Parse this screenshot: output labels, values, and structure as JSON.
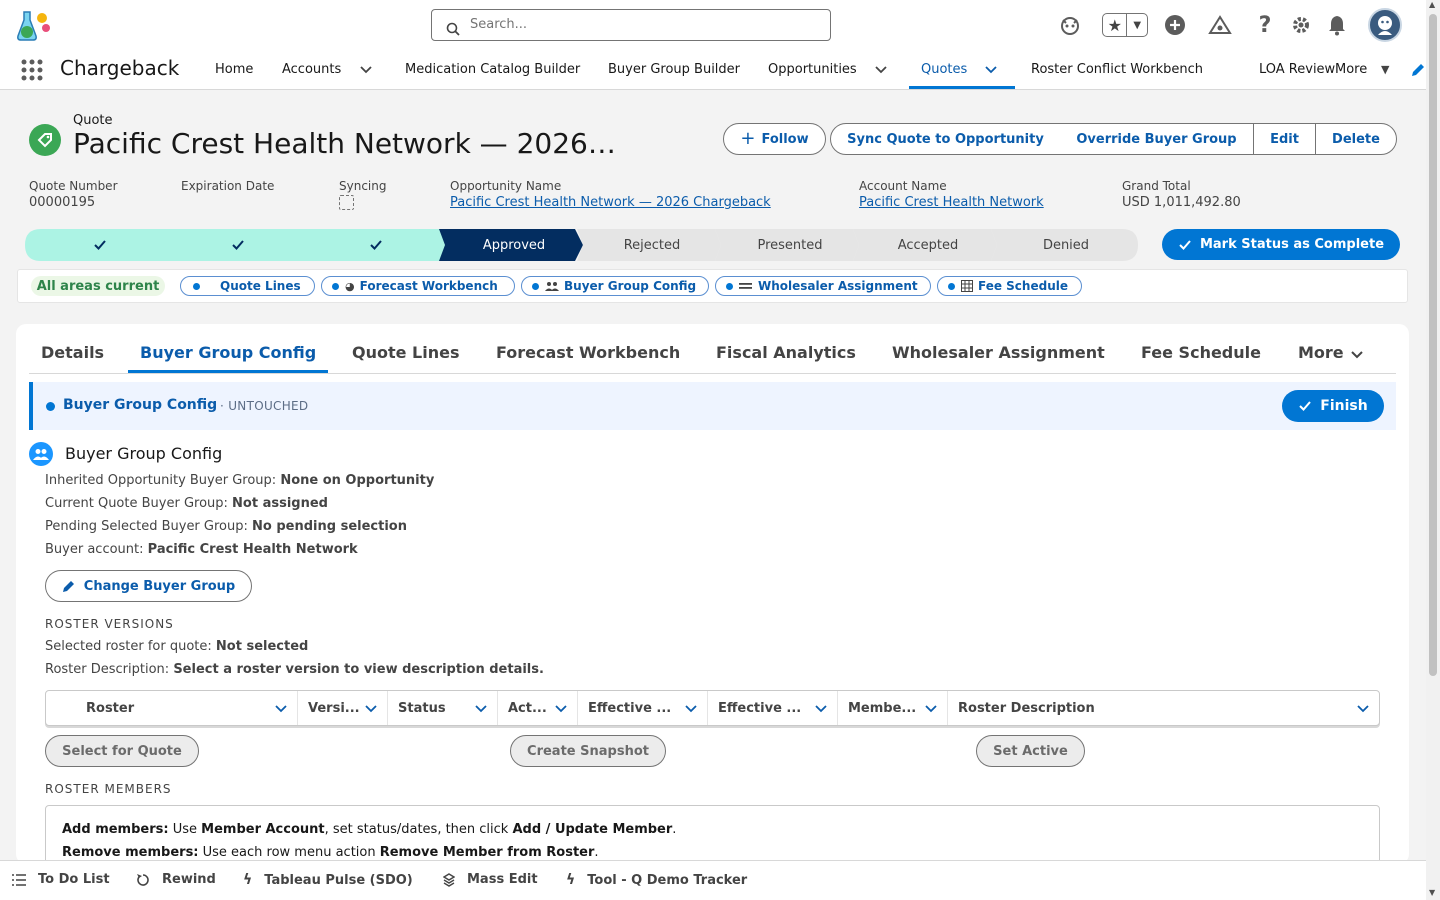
{
  "topbar": {
    "search_placeholder": "Search...",
    "icons": [
      "astro-icon",
      "favorites-star-icon",
      "favorites-dropdown-icon",
      "global-add-icon",
      "trailhead-icon",
      "help-icon",
      "setup-gear-icon",
      "notifications-bell-icon",
      "user-avatar"
    ]
  },
  "nav": {
    "app_name": "Chargeback",
    "items": [
      {
        "label": "Home"
      },
      {
        "label": "Accounts"
      },
      {
        "label": "Medication Catalog Builder"
      },
      {
        "label": "Buyer Group Builder"
      },
      {
        "label": "Opportunities"
      },
      {
        "label": "Quotes"
      },
      {
        "label": "Roster Conflict Workbench"
      },
      {
        "label": "LOA Review"
      },
      {
        "label": "More"
      }
    ]
  },
  "record": {
    "object_label": "Quote",
    "title": "Pacific Crest Health Network — 2026…",
    "actions": {
      "follow": "Follow",
      "sync": "Sync Quote to Opportunity",
      "override": "Override Buyer Group",
      "edit": "Edit",
      "delete": "Delete"
    },
    "fields": [
      {
        "label": "Quote Number",
        "value": "00000195"
      },
      {
        "label": "Expiration Date",
        "value": ""
      },
      {
        "label": "Syncing",
        "value": ""
      },
      {
        "label": "Opportunity Name",
        "value": "Pacific Crest Health Network — 2026 Chargeback"
      },
      {
        "label": "Account Name",
        "value": "Pacific Crest Health Network"
      },
      {
        "label": "Grand Total",
        "value": "USD 1,011,492.80"
      }
    ]
  },
  "path": {
    "stages": [
      "",
      "",
      "",
      "Approved",
      "Rejected",
      "Presented",
      "Accepted",
      "Denied"
    ],
    "complete_button": "Mark Status as Complete"
  },
  "areas": {
    "status": "All areas current",
    "pills": [
      "Quote Lines",
      "Forecast Workbench",
      "Buyer Group Config",
      "Wholesaler Assignment",
      "Fee Schedule"
    ]
  },
  "tabs": [
    "Details",
    "Buyer Group Config",
    "Quote Lines",
    "Forecast Workbench",
    "Fiscal Analytics",
    "Wholesaler Assignment",
    "Fee Schedule",
    "More"
  ],
  "banner": {
    "title": "Buyer Group Config",
    "status": "· UNTOUCHED",
    "finish": "Finish"
  },
  "section": {
    "title": "Buyer Group Config",
    "lines": [
      {
        "label": "Inherited Opportunity Buyer Group: ",
        "value": "None on Opportunity"
      },
      {
        "label": "Current Quote Buyer Group: ",
        "value": "Not assigned"
      },
      {
        "label": "Pending Selected Buyer Group: ",
        "value": "No pending selection"
      },
      {
        "label": "Buyer account: ",
        "value": "Pacific Crest Health Network"
      }
    ],
    "change_button": "Change Buyer Group",
    "roster_heading": "ROSTER VERSIONS",
    "roster_lines": [
      {
        "label": "Selected roster for quote: ",
        "value": "Not selected"
      },
      {
        "label": "Roster Description: ",
        "value": "Select a roster version to view description details."
      }
    ],
    "table_headers": [
      "Roster",
      "Versi...",
      "Status",
      "Act...",
      "Effective ...",
      "Effective ...",
      "Membe...",
      "Roster Description"
    ],
    "table_buttons": {
      "select": "Select for Quote",
      "snapshot": "Create Snapshot",
      "active": "Set Active"
    },
    "members_heading": "ROSTER MEMBERS",
    "members_add": {
      "lead": "Add members:",
      "t1": " Use ",
      "b1": "Member Account",
      "t2": ", set status/dates, then click ",
      "b2": "Add / Update Member",
      "t3": "."
    },
    "members_remove": {
      "lead": "Remove members:",
      "t1": " Use each row menu action ",
      "b1": "Remove Member from Roster",
      "t2": "."
    }
  },
  "utility": [
    "To Do List",
    "Rewind",
    "Tableau Pulse (SDO)",
    "Mass Edit",
    "Tool - Q Demo Tracker"
  ],
  "colors": {
    "brand": "#0176d3",
    "path_done": "#acf3e4",
    "path_current": "#032d60",
    "path_todo": "#e5e5e5",
    "success": "#2e844a"
  }
}
